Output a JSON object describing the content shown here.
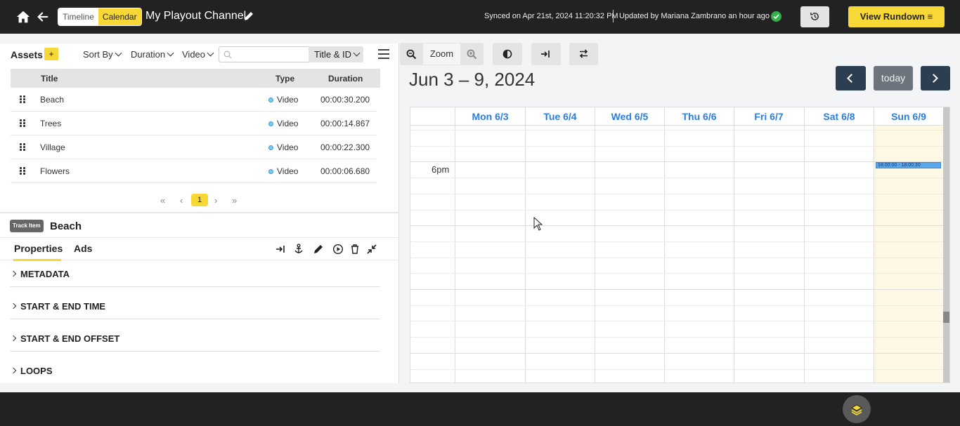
{
  "topbar": {
    "view_timeline": "Timeline",
    "view_calendar": "Calendar",
    "channel_name": "My Playout Channel",
    "sync_text": "Synced on Apr 21st, 2024 11:20:32 PM",
    "updated_text": "Updated by Mariana Zambrano an hour ago",
    "rundown_label": "View Rundown ≡"
  },
  "assets": {
    "title": "Assets",
    "add_label": "+",
    "sort_label": "Sort By",
    "duration_label": "Duration",
    "type_label": "Video",
    "search_placeholder": "",
    "search_scope": "Title & ID",
    "columns": [
      "Title",
      "Type",
      "Duration"
    ],
    "rows": [
      {
        "title": "Beach",
        "type": "Video",
        "duration": "00:00:30.200"
      },
      {
        "title": "Trees",
        "type": "Video",
        "duration": "00:00:14.867"
      },
      {
        "title": "Village",
        "type": "Video",
        "duration": "00:00:22.300"
      },
      {
        "title": "Flowers",
        "type": "Video",
        "duration": "00:00:06.680"
      }
    ],
    "pager": {
      "first": "«",
      "prev": "‹",
      "current": "1",
      "next": "›",
      "last": "»"
    }
  },
  "track": {
    "badge": "Track Item",
    "name": "Beach",
    "tabs": [
      "Properties",
      "Ads"
    ],
    "sections": [
      "METADATA",
      "START & END TIME",
      "START & END OFFSET",
      "LOOPS"
    ]
  },
  "calendar": {
    "zoom_label": "Zoom",
    "range": "Jun 3 – 9, 2024",
    "today_label": "today",
    "days": [
      "Mon 6/3",
      "Tue 6/4",
      "Wed 6/5",
      "Thu 6/6",
      "Fri 6/7",
      "Sat 6/8",
      "Sun 6/9"
    ],
    "time_label": "6pm",
    "event_text": "18:00:00 - 18:00:30"
  },
  "colors": {
    "accent": "#f8d836",
    "topbar": "#222222",
    "link": "#2b7de0",
    "event": "#5aa6ea"
  }
}
